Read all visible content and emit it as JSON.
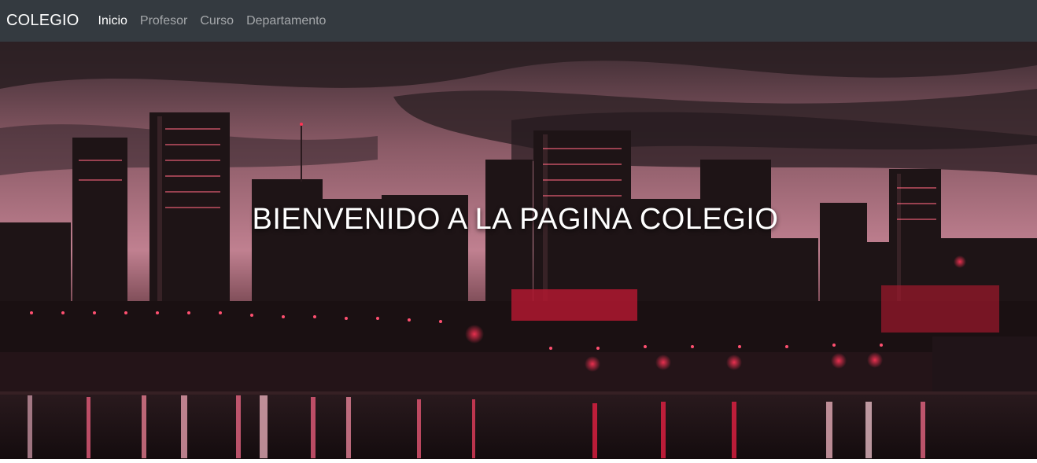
{
  "navbar": {
    "brand": "COLEGIO",
    "links": [
      {
        "label": "Inicio",
        "active": true
      },
      {
        "label": "Profesor",
        "active": false
      },
      {
        "label": "Curso",
        "active": false
      },
      {
        "label": "Departamento",
        "active": false
      }
    ]
  },
  "hero": {
    "title": "BIENVENIDO A LA PAGINA COLEGIO",
    "image": "city-skyline-at-night-red-tint"
  },
  "colors": {
    "navbar_bg": "#343a40",
    "accent_red": "#e0143c"
  }
}
